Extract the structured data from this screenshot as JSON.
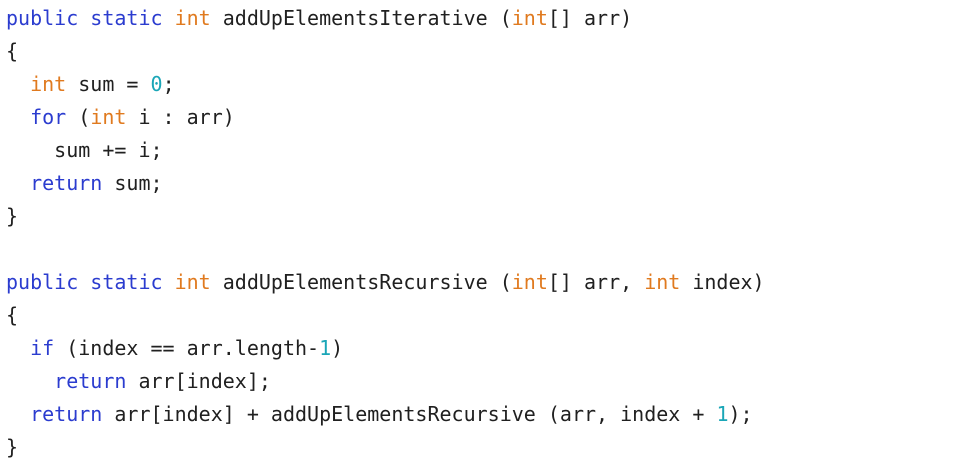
{
  "code": {
    "lines": [
      [
        {
          "t": "public static ",
          "c": "kw"
        },
        {
          "t": "int",
          "c": "type"
        },
        {
          "t": " addUpElementsIterative (",
          "c": "plain"
        },
        {
          "t": "int",
          "c": "type"
        },
        {
          "t": "[] arr)",
          "c": "plain"
        }
      ],
      [
        {
          "t": "{",
          "c": "plain"
        }
      ],
      [
        {
          "t": "  ",
          "c": "plain"
        },
        {
          "t": "int",
          "c": "type"
        },
        {
          "t": " sum = ",
          "c": "plain"
        },
        {
          "t": "0",
          "c": "num"
        },
        {
          "t": ";",
          "c": "plain"
        }
      ],
      [
        {
          "t": "  ",
          "c": "plain"
        },
        {
          "t": "for",
          "c": "kw"
        },
        {
          "t": " (",
          "c": "plain"
        },
        {
          "t": "int",
          "c": "type"
        },
        {
          "t": " i : arr)",
          "c": "plain"
        }
      ],
      [
        {
          "t": "    sum += i;",
          "c": "plain"
        }
      ],
      [
        {
          "t": "  ",
          "c": "plain"
        },
        {
          "t": "return",
          "c": "kw"
        },
        {
          "t": " sum;",
          "c": "plain"
        }
      ],
      [
        {
          "t": "}",
          "c": "plain"
        }
      ],
      [
        {
          "t": "",
          "c": "plain"
        }
      ],
      [
        {
          "t": "public static ",
          "c": "kw"
        },
        {
          "t": "int",
          "c": "type"
        },
        {
          "t": " addUpElementsRecursive (",
          "c": "plain"
        },
        {
          "t": "int",
          "c": "type"
        },
        {
          "t": "[] arr, ",
          "c": "plain"
        },
        {
          "t": "int",
          "c": "type"
        },
        {
          "t": " index)",
          "c": "plain"
        }
      ],
      [
        {
          "t": "{",
          "c": "plain"
        }
      ],
      [
        {
          "t": "  ",
          "c": "plain"
        },
        {
          "t": "if",
          "c": "kw"
        },
        {
          "t": " (index == arr.length-",
          "c": "plain"
        },
        {
          "t": "1",
          "c": "num"
        },
        {
          "t": ")",
          "c": "plain"
        }
      ],
      [
        {
          "t": "    ",
          "c": "plain"
        },
        {
          "t": "return",
          "c": "kw"
        },
        {
          "t": " arr[index];",
          "c": "plain"
        }
      ],
      [
        {
          "t": "  ",
          "c": "plain"
        },
        {
          "t": "return",
          "c": "kw"
        },
        {
          "t": " arr[index] + addUpElementsRecursive (arr, index + ",
          "c": "plain"
        },
        {
          "t": "1",
          "c": "num"
        },
        {
          "t": ");",
          "c": "plain"
        }
      ],
      [
        {
          "t": "}",
          "c": "plain"
        }
      ]
    ]
  },
  "colors": {
    "keyword": "#2b3ccf",
    "type": "#e07a1f",
    "number": "#1aa6b7",
    "text": "#202020",
    "background": "#ffffff"
  }
}
